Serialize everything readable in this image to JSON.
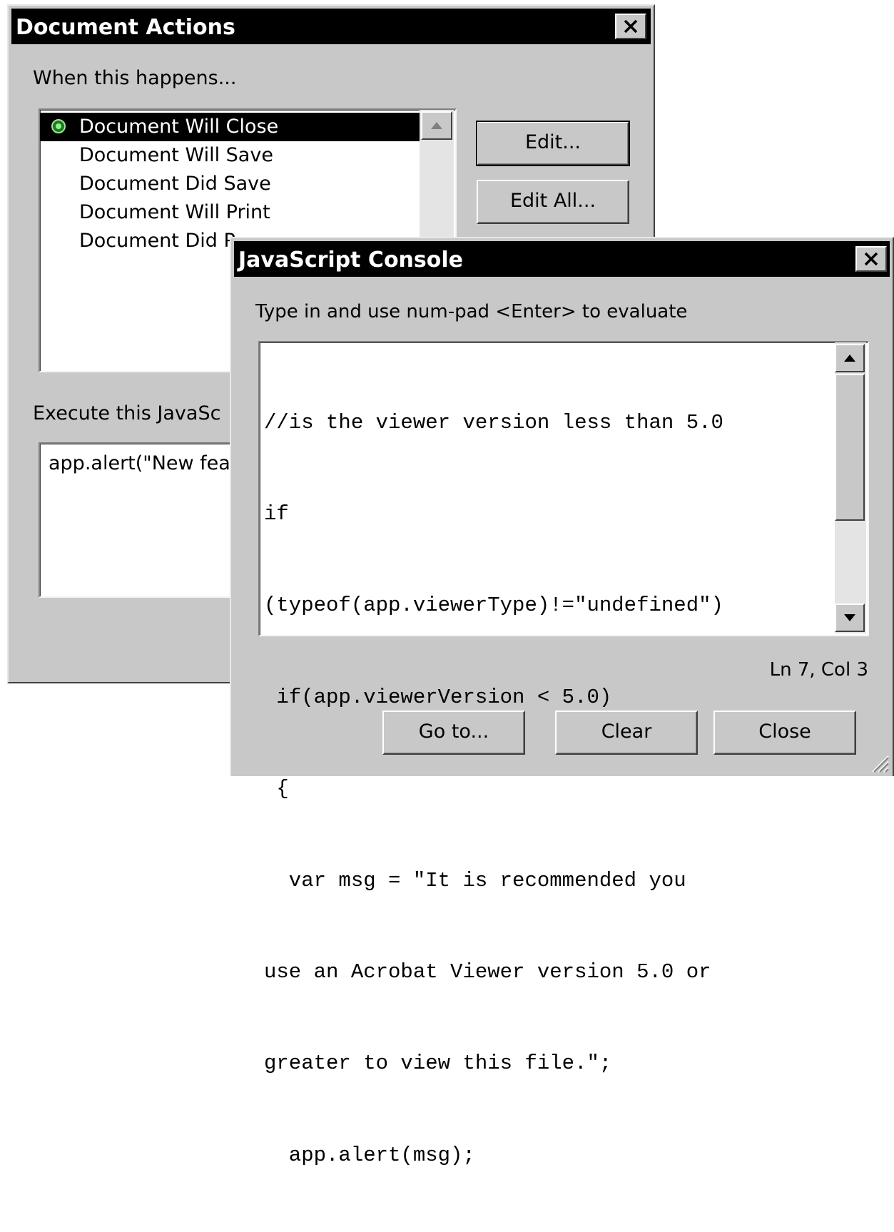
{
  "document_actions": {
    "title": "Document Actions",
    "when_label": "When this happens...",
    "events": [
      {
        "label": "Document Will Close",
        "selected": true
      },
      {
        "label": "Document Will Save",
        "selected": false
      },
      {
        "label": "Document Did Save",
        "selected": false
      },
      {
        "label": "Document Will Print",
        "selected": false
      },
      {
        "label": "Document Did P",
        "selected": false
      }
    ],
    "edit_label": "Edit...",
    "edit_all_label": "Edit All...",
    "execute_label": "Execute this JavaSc",
    "script_preview": "app.alert(\"New fea"
  },
  "js_console": {
    "title": "JavaScript Console",
    "instruction": "Type in and use num-pad <Enter> to evaluate",
    "code_lines": [
      "//is the viewer version less than 5.0",
      "if",
      "(typeof(app.viewerType)!=\"undefined\")",
      " if(app.viewerVersion < 5.0)",
      " {",
      "  var msg = \"It is recommended you",
      "use an Acrobat Viewer version 5.0 or",
      "greater to view this file.\";",
      "  app.alert(msg);"
    ],
    "cursor_status": "Ln 7, Col 3",
    "goto_label": "Go to...",
    "clear_label": "Clear",
    "close_label": "Close"
  }
}
